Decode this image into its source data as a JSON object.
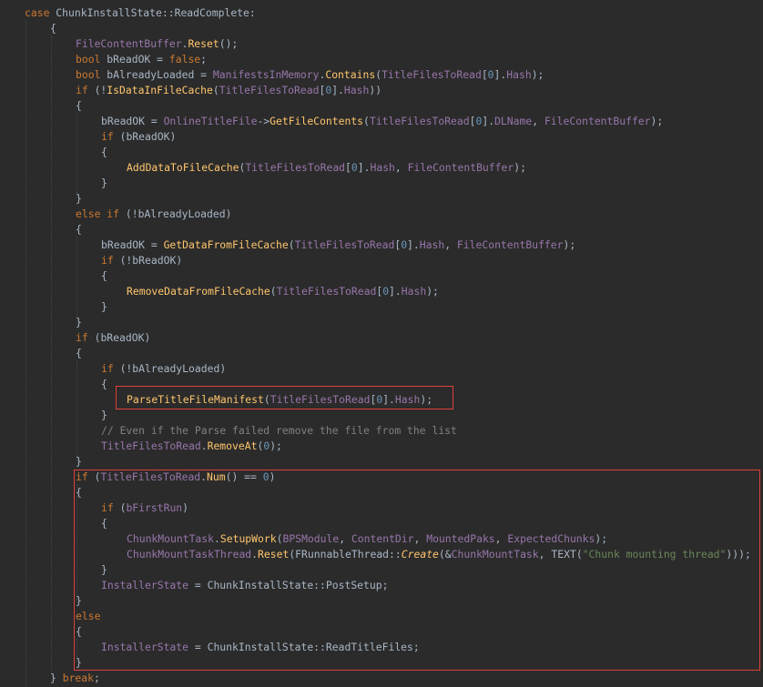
{
  "editor": {
    "language": "cpp",
    "colors": {
      "background": "#2b2b2b",
      "keyword": "#cc7832",
      "text": "#a9b7c6",
      "function": "#ffc66d",
      "member": "#9876aa",
      "number": "#6897bb",
      "string": "#6a8759",
      "comment": "#808080",
      "highlight_box": "#e0403a"
    },
    "lines": [
      {
        "indent": 0,
        "tokens": [
          [
            "k",
            "case "
          ],
          [
            "t",
            "ChunkInstallState::ReadComplete:"
          ]
        ]
      },
      {
        "indent": 1,
        "tokens": [
          [
            "p",
            "{"
          ]
        ]
      },
      {
        "indent": 2,
        "tokens": [
          [
            "m",
            "FileContentBuffer"
          ],
          [
            "p",
            "."
          ],
          [
            "f",
            "Reset"
          ],
          [
            "p",
            "();"
          ]
        ]
      },
      {
        "indent": 2,
        "tokens": [
          [
            "k",
            "bool "
          ],
          [
            "t",
            "bReadOK = "
          ],
          [
            "k",
            "false"
          ],
          [
            "p",
            ";"
          ]
        ]
      },
      {
        "indent": 2,
        "tokens": [
          [
            "k",
            "bool "
          ],
          [
            "t",
            "bAlreadyLoaded = "
          ],
          [
            "m",
            "ManifestsInMemory"
          ],
          [
            "p",
            "."
          ],
          [
            "f",
            "Contains"
          ],
          [
            "p",
            "("
          ],
          [
            "m",
            "TitleFilesToRead"
          ],
          [
            "p",
            "["
          ],
          [
            "n",
            "0"
          ],
          [
            "p",
            "]."
          ],
          [
            "m",
            "Hash"
          ],
          [
            "p",
            ");"
          ]
        ]
      },
      {
        "indent": 2,
        "tokens": [
          [
            "k",
            "if "
          ],
          [
            "p",
            "(!"
          ],
          [
            "f",
            "IsDataInFileCache"
          ],
          [
            "p",
            "("
          ],
          [
            "m",
            "TitleFilesToRead"
          ],
          [
            "p",
            "["
          ],
          [
            "n",
            "0"
          ],
          [
            "p",
            "]."
          ],
          [
            "m",
            "Hash"
          ],
          [
            "p",
            "))"
          ]
        ]
      },
      {
        "indent": 2,
        "tokens": [
          [
            "p",
            "{"
          ]
        ]
      },
      {
        "indent": 3,
        "tokens": [
          [
            "t",
            "bReadOK = "
          ],
          [
            "m",
            "OnlineTitleFile"
          ],
          [
            "p",
            "->"
          ],
          [
            "f",
            "GetFileContents"
          ],
          [
            "p",
            "("
          ],
          [
            "m",
            "TitleFilesToRead"
          ],
          [
            "p",
            "["
          ],
          [
            "n",
            "0"
          ],
          [
            "p",
            "]."
          ],
          [
            "m",
            "DLName"
          ],
          [
            "p",
            ", "
          ],
          [
            "m",
            "FileContentBuffer"
          ],
          [
            "p",
            ");"
          ]
        ]
      },
      {
        "indent": 3,
        "tokens": [
          [
            "k",
            "if "
          ],
          [
            "p",
            "("
          ],
          [
            "t",
            "bReadOK"
          ],
          [
            "p",
            ")"
          ]
        ]
      },
      {
        "indent": 3,
        "tokens": [
          [
            "p",
            "{"
          ]
        ]
      },
      {
        "indent": 4,
        "tokens": [
          [
            "f",
            "AddDataToFileCache"
          ],
          [
            "p",
            "("
          ],
          [
            "m",
            "TitleFilesToRead"
          ],
          [
            "p",
            "["
          ],
          [
            "n",
            "0"
          ],
          [
            "p",
            "]."
          ],
          [
            "m",
            "Hash"
          ],
          [
            "p",
            ", "
          ],
          [
            "m",
            "FileContentBuffer"
          ],
          [
            "p",
            ");"
          ]
        ]
      },
      {
        "indent": 3,
        "tokens": [
          [
            "p",
            "}"
          ]
        ]
      },
      {
        "indent": 2,
        "tokens": [
          [
            "p",
            "}"
          ]
        ]
      },
      {
        "indent": 2,
        "tokens": [
          [
            "k",
            "else if "
          ],
          [
            "p",
            "(!"
          ],
          [
            "t",
            "bAlreadyLoaded"
          ],
          [
            "p",
            ")"
          ]
        ]
      },
      {
        "indent": 2,
        "tokens": [
          [
            "p",
            "{"
          ]
        ]
      },
      {
        "indent": 3,
        "tokens": [
          [
            "t",
            "bReadOK = "
          ],
          [
            "f",
            "GetDataFromFileCache"
          ],
          [
            "p",
            "("
          ],
          [
            "m",
            "TitleFilesToRead"
          ],
          [
            "p",
            "["
          ],
          [
            "n",
            "0"
          ],
          [
            "p",
            "]."
          ],
          [
            "m",
            "Hash"
          ],
          [
            "p",
            ", "
          ],
          [
            "m",
            "FileContentBuffer"
          ],
          [
            "p",
            ");"
          ]
        ]
      },
      {
        "indent": 3,
        "tokens": [
          [
            "k",
            "if "
          ],
          [
            "p",
            "(!"
          ],
          [
            "t",
            "bReadOK"
          ],
          [
            "p",
            ")"
          ]
        ]
      },
      {
        "indent": 3,
        "tokens": [
          [
            "p",
            "{"
          ]
        ]
      },
      {
        "indent": 4,
        "tokens": [
          [
            "f",
            "RemoveDataFromFileCache"
          ],
          [
            "p",
            "("
          ],
          [
            "m",
            "TitleFilesToRead"
          ],
          [
            "p",
            "["
          ],
          [
            "n",
            "0"
          ],
          [
            "p",
            "]."
          ],
          [
            "m",
            "Hash"
          ],
          [
            "p",
            ");"
          ]
        ]
      },
      {
        "indent": 3,
        "tokens": [
          [
            "p",
            "}"
          ]
        ]
      },
      {
        "indent": 2,
        "tokens": [
          [
            "p",
            "}"
          ]
        ]
      },
      {
        "indent": 2,
        "tokens": [
          [
            "k",
            "if "
          ],
          [
            "p",
            "("
          ],
          [
            "t",
            "bReadOK"
          ],
          [
            "p",
            ")"
          ]
        ]
      },
      {
        "indent": 2,
        "tokens": [
          [
            "p",
            "{"
          ]
        ]
      },
      {
        "indent": 3,
        "tokens": [
          [
            "k",
            "if "
          ],
          [
            "p",
            "(!"
          ],
          [
            "t",
            "bAlreadyLoaded"
          ],
          [
            "p",
            ")"
          ]
        ]
      },
      {
        "indent": 3,
        "tokens": [
          [
            "p",
            "{"
          ]
        ]
      },
      {
        "indent": 4,
        "tokens": [
          [
            "f",
            "ParseTitleFileManifest"
          ],
          [
            "p",
            "("
          ],
          [
            "m",
            "TitleFilesToRead"
          ],
          [
            "p",
            "["
          ],
          [
            "n",
            "0"
          ],
          [
            "p",
            "]."
          ],
          [
            "m",
            "Hash"
          ],
          [
            "p",
            ");"
          ]
        ]
      },
      {
        "indent": 3,
        "tokens": [
          [
            "p",
            "}"
          ]
        ]
      },
      {
        "indent": 3,
        "tokens": [
          [
            "c",
            "// Even if the Parse failed remove the file from the list"
          ]
        ]
      },
      {
        "indent": 3,
        "tokens": [
          [
            "m",
            "TitleFilesToRead"
          ],
          [
            "p",
            "."
          ],
          [
            "f",
            "RemoveAt"
          ],
          [
            "p",
            "("
          ],
          [
            "n",
            "0"
          ],
          [
            "p",
            ");"
          ]
        ]
      },
      {
        "indent": 2,
        "tokens": [
          [
            "p",
            "}"
          ]
        ]
      },
      {
        "indent": 2,
        "tokens": [
          [
            "k",
            "if "
          ],
          [
            "p",
            "("
          ],
          [
            "m",
            "TitleFilesToRead"
          ],
          [
            "p",
            "."
          ],
          [
            "f",
            "Num"
          ],
          [
            "p",
            "() == "
          ],
          [
            "n",
            "0"
          ],
          [
            "p",
            ")"
          ]
        ]
      },
      {
        "indent": 2,
        "tokens": [
          [
            "p",
            "{"
          ]
        ]
      },
      {
        "indent": 3,
        "tokens": [
          [
            "k",
            "if "
          ],
          [
            "p",
            "("
          ],
          [
            "m",
            "bFirstRun"
          ],
          [
            "p",
            ")"
          ]
        ]
      },
      {
        "indent": 3,
        "tokens": [
          [
            "p",
            "{"
          ]
        ]
      },
      {
        "indent": 4,
        "tokens": [
          [
            "m",
            "ChunkMountTask"
          ],
          [
            "p",
            "."
          ],
          [
            "f",
            "SetupWork"
          ],
          [
            "p",
            "("
          ],
          [
            "m",
            "BPSModule"
          ],
          [
            "p",
            ", "
          ],
          [
            "m",
            "ContentDir"
          ],
          [
            "p",
            ", "
          ],
          [
            "m",
            "MountedPaks"
          ],
          [
            "p",
            ", "
          ],
          [
            "m",
            "ExpectedChunks"
          ],
          [
            "p",
            ");"
          ]
        ]
      },
      {
        "indent": 4,
        "tokens": [
          [
            "m",
            "ChunkMountTaskThread"
          ],
          [
            "p",
            "."
          ],
          [
            "f",
            "Reset"
          ],
          [
            "p",
            "("
          ],
          [
            "t",
            "FRunnableThread::"
          ],
          [
            "i",
            "Create"
          ],
          [
            "p",
            "(&"
          ],
          [
            "m",
            "ChunkMountTask"
          ],
          [
            "p",
            ", "
          ],
          [
            "t",
            "TEXT"
          ],
          [
            "p",
            "("
          ],
          [
            "s",
            "\"Chunk mounting thread\""
          ],
          [
            "p",
            ")));"
          ]
        ]
      },
      {
        "indent": 3,
        "tokens": [
          [
            "p",
            "}"
          ]
        ]
      },
      {
        "indent": 3,
        "tokens": [
          [
            "m",
            "InstallerState"
          ],
          [
            "t",
            " = ChunkInstallState::PostSetup;"
          ]
        ]
      },
      {
        "indent": 2,
        "tokens": [
          [
            "p",
            "}"
          ]
        ]
      },
      {
        "indent": 2,
        "tokens": [
          [
            "k",
            "else"
          ]
        ]
      },
      {
        "indent": 2,
        "tokens": [
          [
            "p",
            "{"
          ]
        ]
      },
      {
        "indent": 3,
        "tokens": [
          [
            "m",
            "InstallerState"
          ],
          [
            "t",
            " = ChunkInstallState::ReadTitleFiles;"
          ]
        ]
      },
      {
        "indent": 2,
        "tokens": [
          [
            "p",
            "}"
          ]
        ]
      },
      {
        "indent": 1,
        "tokens": [
          [
            "p",
            "} "
          ],
          [
            "k",
            "break"
          ],
          [
            "p",
            ";"
          ]
        ]
      }
    ]
  }
}
